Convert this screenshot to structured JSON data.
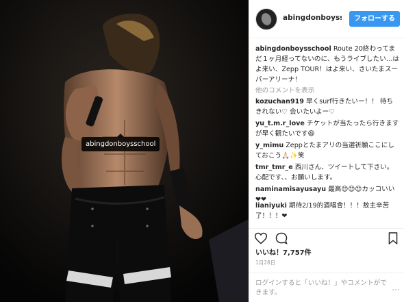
{
  "photo": {
    "tag_label": "abingdonboysschool"
  },
  "header": {
    "username": "abingdonboysschool",
    "follow_label": "フォローする"
  },
  "caption": {
    "username": "abingdonboysschool",
    "text": "Route 20終わってまだ１ヶ月経ってないのに、もうライブしたい…はよ来い、Zepp TOUR！はよ来い、さいたまスーパーアリーナ！"
  },
  "more_comments": "他のコメントを表示",
  "comments": [
    {
      "user": "kozuchan919",
      "text": "早くsurf行きたいー！！ 待ちきれない♡ 会いたいよー♡"
    },
    {
      "user": "yu_t.m.r_love",
      "text": "チケットが当たったら行きますが早く観たいです😆"
    },
    {
      "user": "y_mimu",
      "text": "Zeppとたまアリの当選祈願ここにしておこう🙏🏻✨笑"
    },
    {
      "user": "tmr_tmr_e",
      "text": "西川さん、ツイートして下さい。心配です、、お願いします。"
    },
    {
      "user": "naminamisayusayu",
      "text": "最高😍😍😍カッコいい❤❤"
    },
    {
      "user": "lianiyuki",
      "text": "期待2/19的酒唱會！！！敖主辛苦了！！！❤"
    }
  ],
  "likes": "いいね！7,757件",
  "date": "1月28日",
  "login_prompt": "ログインすると「いいね！」やコメントができます。",
  "more_icon": "…"
}
